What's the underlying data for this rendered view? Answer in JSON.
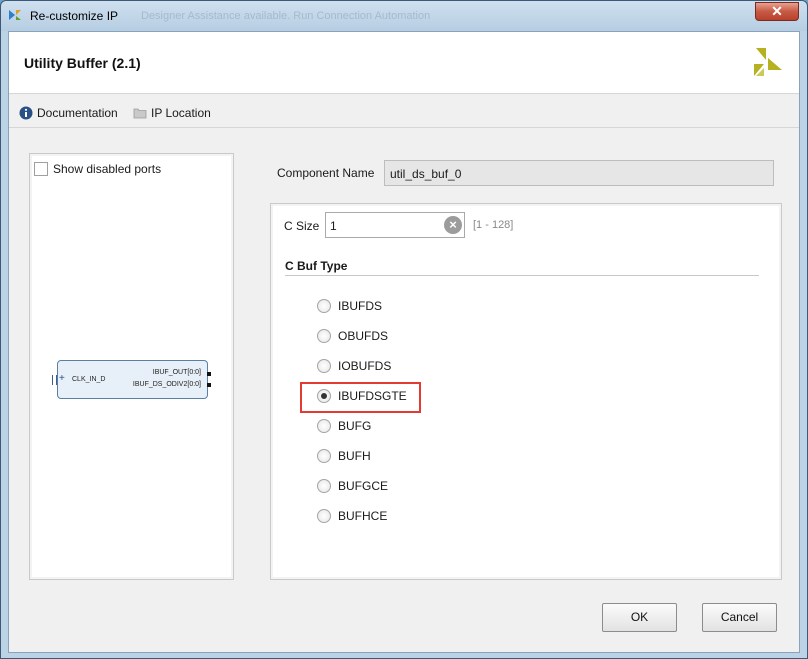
{
  "window": {
    "title": "Re-customize IP",
    "ghost_text": "Designer Assistance available. Run Connection Automation",
    "close_label": "✕"
  },
  "header": {
    "title": "Utility Buffer (2.1)"
  },
  "links": {
    "documentation": "Documentation",
    "ip_location": "IP Location"
  },
  "left_panel": {
    "show_disabled_ports_label": "Show disabled ports",
    "show_disabled_ports_checked": false,
    "block": {
      "input_port": "CLK_IN_D",
      "output_ports": [
        "IBUF_OUT[0:0]",
        "IBUF_DS_ODIV2[0:0]"
      ]
    }
  },
  "component": {
    "label": "Component Name",
    "value": "util_ds_buf_0"
  },
  "config": {
    "c_size_label": "C Size",
    "c_size_value": "1",
    "c_size_range": "[1 - 128]",
    "buf_type_title": "C Buf Type",
    "buf_types": [
      "IBUFDS",
      "OBUFDS",
      "IOBUFDS",
      "IBUFDSGTE",
      "BUFG",
      "BUFH",
      "BUFGCE",
      "BUFHCE"
    ],
    "selected": "IBUFDSGTE"
  },
  "buttons": {
    "ok": "OK",
    "cancel": "Cancel"
  },
  "colors": {
    "highlight": "#e33a32",
    "logo_yellow": "#b6b11e"
  }
}
